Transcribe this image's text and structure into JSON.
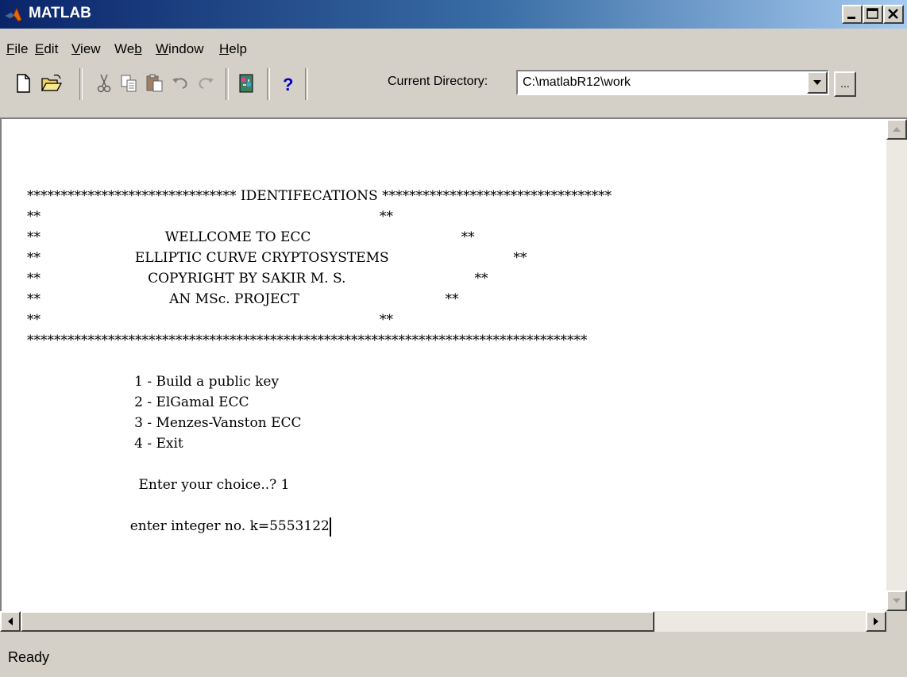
{
  "window": {
    "title": "MATLAB"
  },
  "menu": {
    "items": [
      {
        "label": "File"
      },
      {
        "label": "Edit"
      },
      {
        "label": "View"
      },
      {
        "label": "Web"
      },
      {
        "label": "Window"
      },
      {
        "label": "Help"
      }
    ]
  },
  "toolbar": {
    "icons": [
      "new-file-icon",
      "open-folder-icon",
      "cut-icon",
      "copy-icon",
      "paste-icon",
      "undo-icon",
      "redo-icon",
      "simulink-icon",
      "help-icon"
    ],
    "current_directory_label": "Current Directory:",
    "current_directory_value": "C:\\matlabR12\\work",
    "browse_label": "..."
  },
  "command_window": {
    "lines": [
      "******************************* IDENTIFECATIONS **********************************",
      "**                                                                               **",
      "**                             WELLCOME TO ECC                                   **",
      "**                      ELLIPTIC CURVE CRYPTOSYSTEMS                             **",
      "**                         COPYRIGHT BY SAKIR M. S.                              **",
      "**                              AN MSc. PROJECT                                  **",
      "**                                                                               **",
      "***********************************************************************************",
      "",
      "                         1 - Build a public key",
      "                         2 - ElGamal ECC",
      "                         3 - Menzes-Vanston ECC",
      "                         4 - Exit",
      "",
      "                          Enter your choice..? 1",
      "",
      "                        enter integer no. k=5553122"
    ]
  },
  "status": {
    "text": "Ready"
  }
}
